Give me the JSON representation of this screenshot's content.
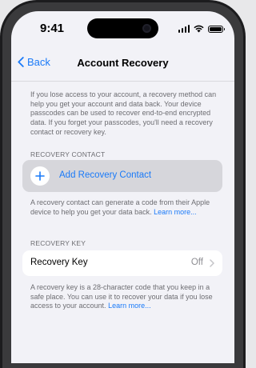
{
  "status_bar": {
    "time": "9:41"
  },
  "nav": {
    "back_label": "Back",
    "title": "Account Recovery"
  },
  "intro_text": "If you lose access to your account, a recovery method can help you get your account and data back. Your device passcodes can be used to recover end-to-end encrypted data. If you forget your passcodes, you'll need a recovery contact or recovery key.",
  "recovery_contact": {
    "header": "RECOVERY CONTACT",
    "add_label": "Add Recovery Contact",
    "footnote": "A recovery contact can generate a code from their Apple device to help you get your data back.",
    "footnote_link": "Learn more..."
  },
  "recovery_key": {
    "header": "RECOVERY KEY",
    "label": "Recovery Key",
    "value": "Off",
    "footnote": "A recovery key is a 28-character code that you keep in a safe place. You can use it to recover your data if you lose access to your account.",
    "footnote_link": "Learn more..."
  },
  "colors": {
    "accent": "#1a7af8",
    "background": "#f2f2f7",
    "secondary_text": "#6d6d72"
  }
}
